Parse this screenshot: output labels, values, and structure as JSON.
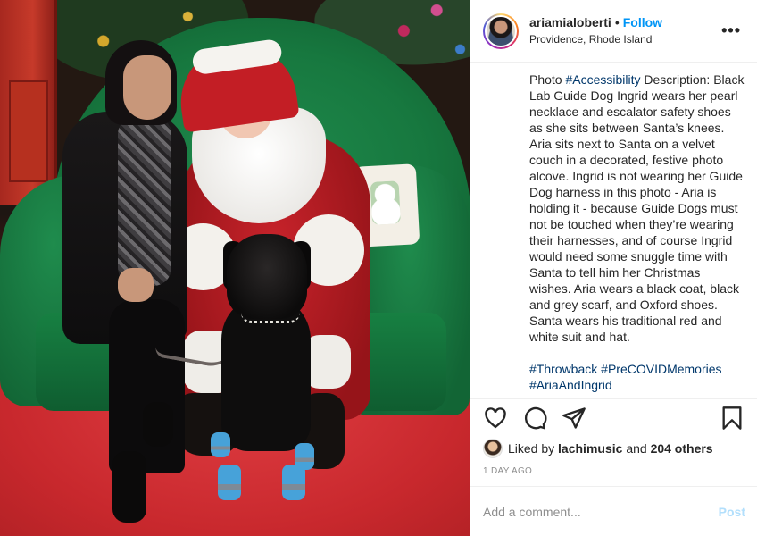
{
  "photo": {
    "alt_label": ""
  },
  "header": {
    "username": "ariamialoberti",
    "separator": "•",
    "follow_label": "Follow",
    "location": "Providence, Rhode Island",
    "more_label": "•••"
  },
  "caption": {
    "lead_word": "Photo ",
    "lead_tag": "#Accessibility",
    "body": " Description: Black Lab Guide Dog Ingrid wears her pearl necklace and escalator safety shoes as she sits between Santa’s knees. Aria sits next to Santa on a velvet couch in a decorated, festive photo alcove. Ingrid is not wearing her Guide Dog harness in this photo - Aria is holding it - because Guide Dogs must not be touched when they’re wearing their harnesses, and of course Ingrid would need some snuggle time with Santa to tell him her Christmas wishes. Aria wears a black coat, black and grey scarf, and Oxford shoes. Santa wears his traditional red and white suit and hat.",
    "hashtags": [
      "#Throwback",
      "#PreCOVIDMemories",
      "#AriaAndIngrid"
    ]
  },
  "actions": {
    "icons": [
      "heart-icon",
      "comment-icon",
      "share-icon",
      "bookmark-icon"
    ]
  },
  "likes": {
    "prefix": "Liked by ",
    "user": "lachimusic",
    "middle": " and ",
    "count": "204 others"
  },
  "timestamp": "1 DAY AGO",
  "comment": {
    "placeholder": "Add a comment...",
    "post_label": "Post"
  },
  "colors": {
    "link_blue": "#0095f6",
    "hashtag_blue": "#00376b",
    "muted": "#8e8e8e",
    "post_disabled": "#b2dffc"
  }
}
